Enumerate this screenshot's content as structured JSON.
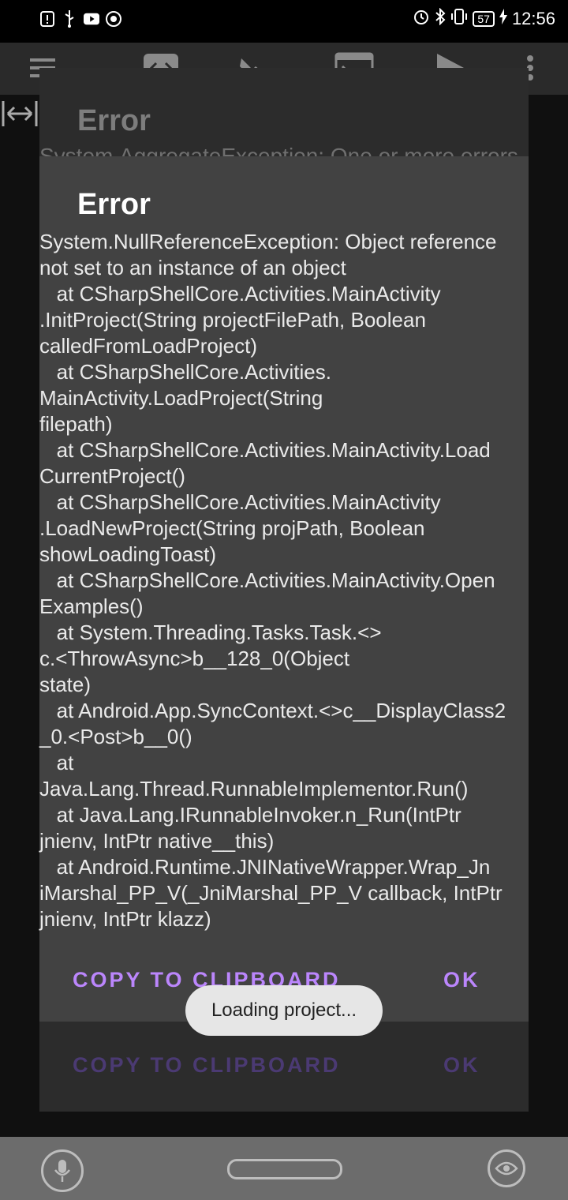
{
  "status_bar": {
    "left_icons": [
      "alert-icon",
      "usb-icon",
      "youtube-icon",
      "chrome-icon"
    ],
    "right_icons": [
      "alarm-icon",
      "bluetooth-icon",
      "vibrate-icon"
    ],
    "battery": "57",
    "time": "12:56"
  },
  "toolbar": {
    "icons": [
      "menu-icon",
      "code-icon",
      "wrench-icon",
      "console-icon",
      "run-icon",
      "more-icon"
    ]
  },
  "background_dialog": {
    "title": "Error",
    "message": "System.AggregateException: One or more errors",
    "copy_label": "COPY TO CLIPBOARD",
    "ok_label": "OK"
  },
  "dialog": {
    "title": "Error",
    "message": "System.NullReferenceException: Object reference\nnot set to an instance of an object\n   at CSharpShellCore.Activities.MainActivity\n.InitProject(String projectFilePath, Boolean\ncalledFromLoadProject)\n   at CSharpShellCore.Activities.\nMainActivity.LoadProject(String\nfilepath)\n   at CSharpShellCore.Activities.MainActivity.Load\nCurrentProject()\n   at CSharpShellCore.Activities.MainActivity\n.LoadNewProject(String projPath, Boolean\nshowLoadingToast)\n   at CSharpShellCore.Activities.MainActivity.Open\nExamples()\n   at System.Threading.Tasks.Task.<>\nc.<ThrowAsync>b__128_0(Object\nstate)\n   at Android.App.SyncContext.<>c__DisplayClass2\n_0.<Post>b__0()\n   at\nJava.Lang.Thread.RunnableImplementor.Run()\n   at Java.Lang.IRunnableInvoker.n_Run(IntPtr\njnienv, IntPtr native__this)\n   at Android.Runtime.JNINativeWrapper.Wrap_Jn\niMarshal_PP_V(_JniMarshal_PP_V callback, IntPtr\njnienv, IntPtr klazz)",
    "copy_label": "COPY TO CLIPBOARD",
    "ok_label": "OK"
  },
  "toast": {
    "text": "Loading project..."
  },
  "nav_bar": {
    "icons": [
      "mic-icon",
      "home-pill",
      "eye-icon"
    ]
  },
  "colors": {
    "accent": "#bb86fc",
    "dialog_bg": "#424242",
    "toast_bg": "#e6e6e6"
  }
}
